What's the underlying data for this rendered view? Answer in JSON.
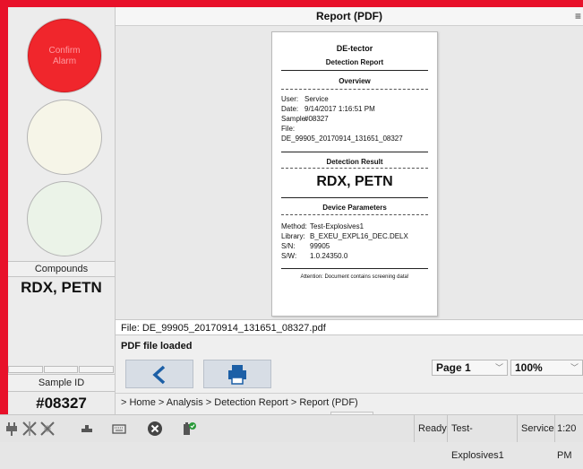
{
  "left": {
    "alarm_label_line1": "Confirm",
    "alarm_label_line2": "Alarm",
    "compounds_label": "Compounds",
    "compounds_value": "RDX, PETN",
    "sample_id_label": "Sample ID",
    "sample_id_value": "#08327"
  },
  "header": {
    "title": "Report (PDF)",
    "menu_icon": "hamburger-menu-icon"
  },
  "report": {
    "brand": "DE-tector",
    "subtitle": "Detection Report",
    "overview_title": "Overview",
    "overview": {
      "user_k": "User:",
      "user_v": "Service",
      "date_k": "Date:",
      "date_v": "9/14/2017 1:16:51 PM",
      "sample_k": "Sample:",
      "sample_v": "#08327",
      "file_k": "File:",
      "file_v": "DE_99905_20170914_131651_08327"
    },
    "result_title": "Detection Result",
    "result_value": "RDX, PETN",
    "params_title": "Device Parameters",
    "params": {
      "method_k": "Method:",
      "method_v": "Test-Explosives1",
      "library_k": "Library:",
      "library_v": "B_EXEU_EXPL16_DEC.DELX",
      "sn_k": "S/N:",
      "sn_v": "99905",
      "sw_k": "S/W:",
      "sw_v": "1.0.24350.0"
    },
    "attention": "Attention: Document contains screening data!"
  },
  "file_line": "File: DE_99905_20170914_131651_08327.pdf",
  "status_line": "PDF file loaded",
  "controls": {
    "page_value": "Page 1",
    "zoom_value": "100%"
  },
  "breadcrumb": "> Home > Analysis > Detection Report > Report (PDF)",
  "taskbar": {
    "status": "Ready",
    "method": "Test-Explosives1",
    "user": "Service",
    "time": "1:20 PM"
  },
  "colors": {
    "frame": "#e8112a",
    "alarm_red": "#f0262c",
    "button_blue": "#1c5fa6"
  }
}
